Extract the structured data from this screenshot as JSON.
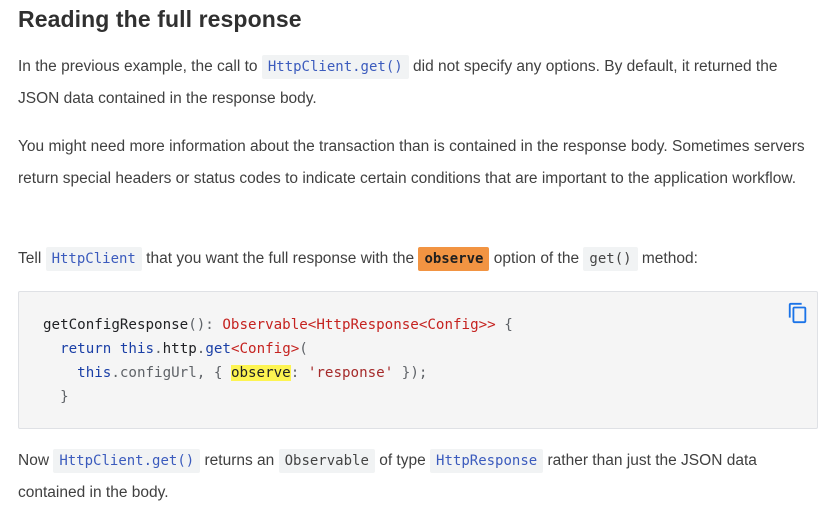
{
  "section": {
    "heading": "Reading the full response"
  },
  "para1": {
    "t1": "In the previous example, the call to ",
    "code1": "HttpClient.get()",
    "t2": " did not specify any options. By default, it returned the JSON data contained in the response body."
  },
  "para2": {
    "text": "You might need more information about the transaction than is contained in the response body. Sometimes servers return special headers or status codes to indicate certain conditions that are important to the application workflow."
  },
  "para3": {
    "t1": "Tell ",
    "code1": "HttpClient",
    "t2": " that you want the full response with the ",
    "code2": "observe",
    "t3": " option of the ",
    "code3": "get()",
    "t4": " method:"
  },
  "code_block": {
    "line1": {
      "fn": "getConfigResponse",
      "p1": "(): ",
      "type1": "Observable<HttpResponse<Config>>",
      "p2": " {"
    },
    "line2": {
      "kw1": "return",
      "sp": " ",
      "kw2": "this",
      "p1": ".",
      "prop": "http",
      "p2": ".",
      "fn": "get",
      "type": "<Config>",
      "p3": "("
    },
    "line3": {
      "kw": "this",
      "p1": ".configUrl, { ",
      "hl": "observe",
      "p2": ": ",
      "str": "'response'",
      "p3": " });"
    },
    "line4": {
      "close": "}"
    },
    "copy_icon": "copy-icon"
  },
  "para4": {
    "t1": "Now ",
    "code1": "HttpClient.get()",
    "t2": " returns an ",
    "code2": "Observable",
    "t3": " of type ",
    "code3": "HttpResponse",
    "t4": " rather than just the JSON data contained in the body."
  },
  "colors": {
    "heading": "#303030",
    "body_text": "#404040",
    "inline_code_bg": "#f1f3f4",
    "observe_highlight": "#f29442",
    "code_highlight_yellow": "#fdf451",
    "code_type_red": "#c5221f",
    "code_keyword_blue": "#1a3fa6",
    "copy_icon_blue": "#1a73e8"
  }
}
